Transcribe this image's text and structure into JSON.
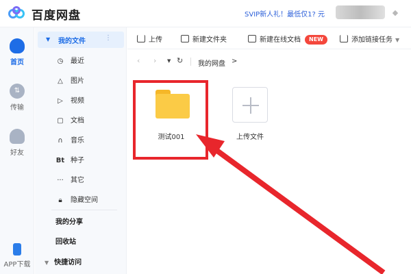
{
  "app": {
    "title": "百度网盘",
    "promo": "SVIP新人礼！最低仅1? 元"
  },
  "rail": {
    "home": "首页",
    "transfer": "传输",
    "friends": "好友",
    "app_download": "APP下载"
  },
  "sidebar": {
    "my_files": "我的文件",
    "items": [
      {
        "label": "最近",
        "icon": "clock-icon"
      },
      {
        "label": "图片",
        "icon": "mountain-icon"
      },
      {
        "label": "视频",
        "icon": "play-icon"
      },
      {
        "label": "文档",
        "icon": "document-icon"
      },
      {
        "label": "音乐",
        "icon": "headphones-icon"
      },
      {
        "label": "种子",
        "icon": "bt-icon"
      },
      {
        "label": "其它",
        "icon": "ellipsis-icon"
      },
      {
        "label": "隐藏空间",
        "icon": "lock-icon"
      }
    ],
    "my_share": "我的分享",
    "recycle_bin": "回收站",
    "quick_access": "快捷访问"
  },
  "toolbar": {
    "upload": "上传",
    "new_folder": "新建文件夹",
    "new_online_doc": "新建在线文档",
    "new_badge": "NEW",
    "add_link_task": "添加链接任务"
  },
  "breadcrumb": {
    "path": "我的网盘",
    "separator": ">"
  },
  "files": [
    {
      "name": "测试001",
      "type": "folder"
    }
  ],
  "upload_tile": {
    "label": "上传文件"
  },
  "colors": {
    "accent": "#1e6de6",
    "highlight": "#e8262c",
    "folder": "#fbcb46",
    "new_badge": "#f4473c"
  }
}
